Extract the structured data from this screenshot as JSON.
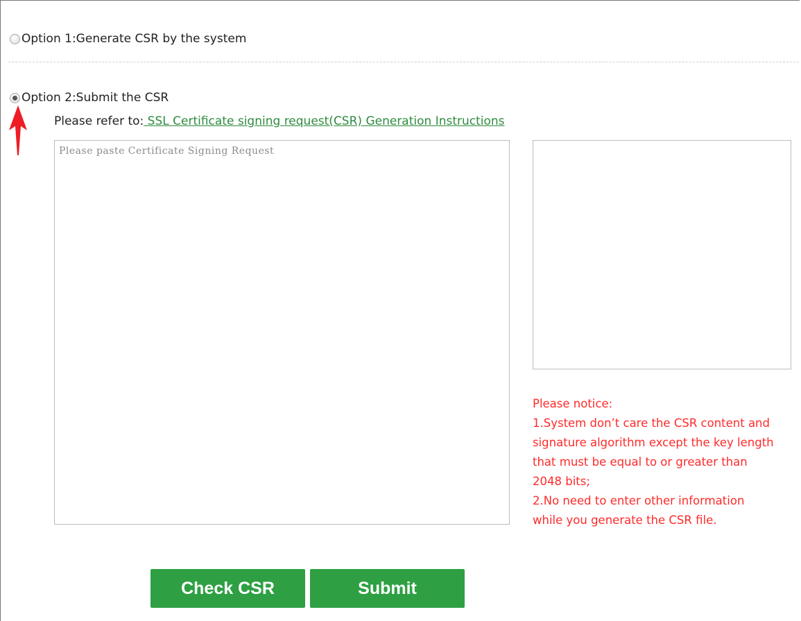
{
  "options": {
    "option1_label": "Option 1:Generate CSR by the system",
    "option2_label": "Option 2:Submit the CSR",
    "selected": "option2"
  },
  "refer": {
    "prefix": "Please refer to:",
    "link_text": " SSL Certificate signing request(CSR) Generation Instructions"
  },
  "csr_input": {
    "placeholder": "Please paste Certificate Signing Request",
    "value": ""
  },
  "notice": {
    "lines": [
      "Please notice:",
      "1.System don’t care the CSR content and",
      "signature algorithm except the key length",
      "that must be equal to or greater than",
      "2048 bits;",
      "2.No need to enter other information",
      "while you generate the CSR file."
    ]
  },
  "buttons": {
    "check_label": "Check CSR",
    "submit_label": "Submit"
  },
  "colors": {
    "accent_green": "#2ea043",
    "link_green": "#2e8b3e",
    "notice_red": "#ff2a2a",
    "arrow_red": "#ee1c24"
  },
  "icons": {
    "annotation": "red-up-arrow-icon"
  }
}
